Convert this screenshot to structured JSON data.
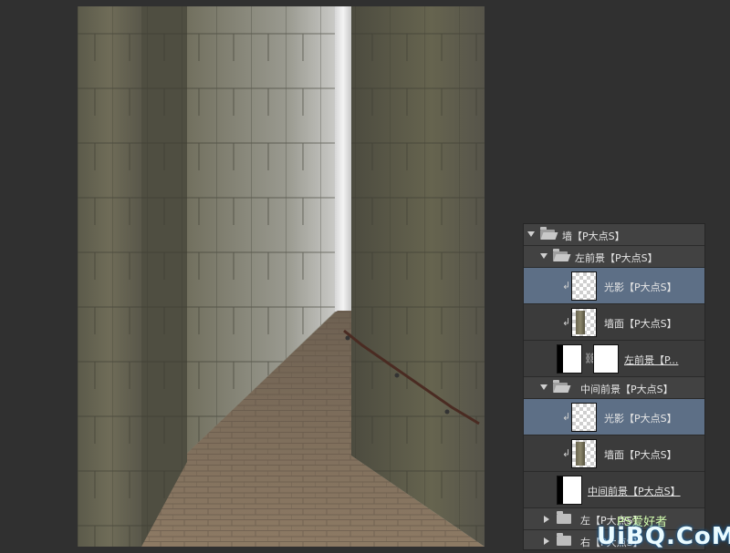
{
  "layers_panel": {
    "rows": [
      {
        "type": "group",
        "label": "墙【P大点S】",
        "expanded": true,
        "depth": 0
      },
      {
        "type": "group",
        "label": "左前景【P大点S】",
        "expanded": true,
        "depth": 1
      },
      {
        "type": "layer",
        "label": "光影【P大点S】",
        "clipped": true,
        "selected": true,
        "thumb": "transparent"
      },
      {
        "type": "layer",
        "label": "墙面【P大点S】",
        "clipped": true,
        "selected": false,
        "thumb": "wall"
      },
      {
        "type": "layer",
        "label": "左前景【P...",
        "clipped": false,
        "selected": false,
        "thumb": "masked",
        "underlined": true
      },
      {
        "type": "group",
        "label": "中间前景【P大点S】",
        "expanded": true,
        "depth": 1
      },
      {
        "type": "layer",
        "label": "光影【P大点S】",
        "clipped": true,
        "selected": true,
        "thumb": "transparent"
      },
      {
        "type": "layer",
        "label": "墙面【P大点S】",
        "clipped": true,
        "selected": false,
        "thumb": "wall"
      },
      {
        "type": "layer",
        "label": "中间前景【P大点S】",
        "clipped": false,
        "selected": false,
        "thumb": "mask-dark",
        "underlined": true
      },
      {
        "type": "group",
        "label": "左【P大点S】",
        "expanded": false,
        "depth": 0
      },
      {
        "type": "group",
        "label": "右【P大点S】",
        "expanded": false,
        "depth": 0
      }
    ]
  },
  "watermark": {
    "top": "PS爱好者",
    "main": "UiBQ.CoM"
  },
  "colors": {
    "panel_bg": "#3b3b3b",
    "selected_row": "#5d6f86",
    "workspace": "#303030"
  }
}
